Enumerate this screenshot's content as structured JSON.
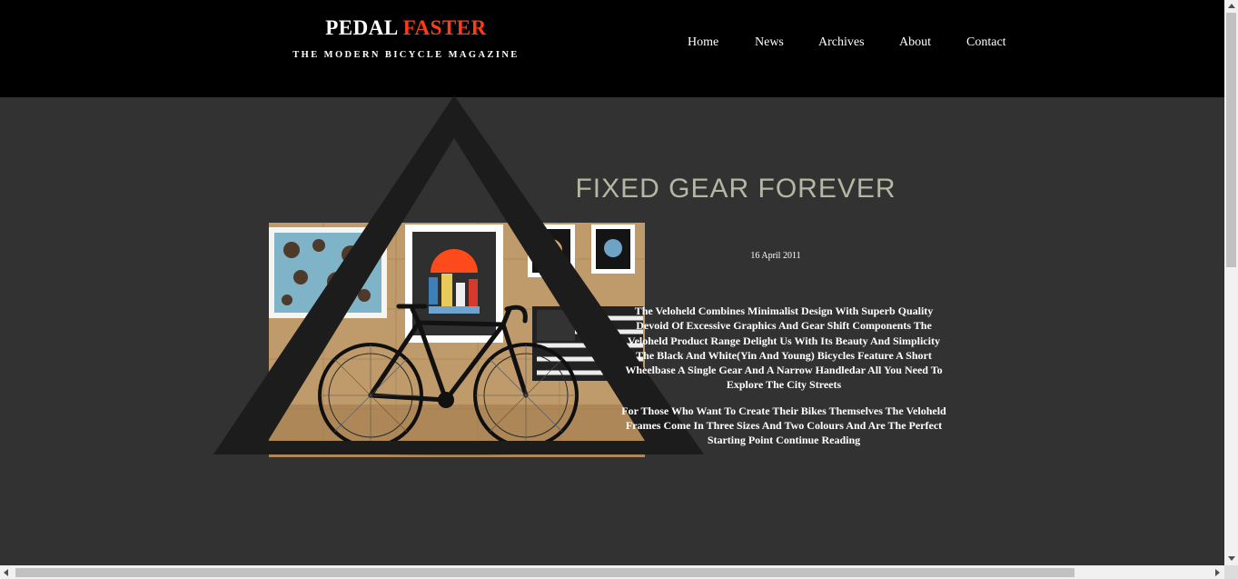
{
  "header": {
    "brand_primary": "PEDAL",
    "brand_accent": "FASTER",
    "tagline": "THE MODERN BICYCLE MAGAZINE"
  },
  "nav": {
    "items": [
      {
        "label": "Home"
      },
      {
        "label": "News"
      },
      {
        "label": "Archives"
      },
      {
        "label": "About"
      },
      {
        "label": "Contact"
      }
    ]
  },
  "post": {
    "title": "FIXED GEAR FOREVER",
    "date": "16 April 2011",
    "paragraphs": [
      "The Veloheld Combines Minimalist Design With Superb Quality Devoid Of Excessive Graphics And Gear Shift Components The Veloheld Product Range Delight Us With Its Beauty And Simplicity The Black And White(Yin And Young) Bicycles Feature A Short Wheelbase A Single Gear And A Narrow Handledar All You Need To Explore The City Streets",
      "For Those Who Want To Create Their Bikes Themselves The Veloheld Frames Come In Three Sizes And Two Colours And Are The Perfect Starting Point Continue Reading"
    ]
  },
  "colors": {
    "header_bg": "#000000",
    "page_bg": "#323232",
    "accent": "#ff3d14",
    "title": "#b3b8a3",
    "text": "#ffffff"
  }
}
